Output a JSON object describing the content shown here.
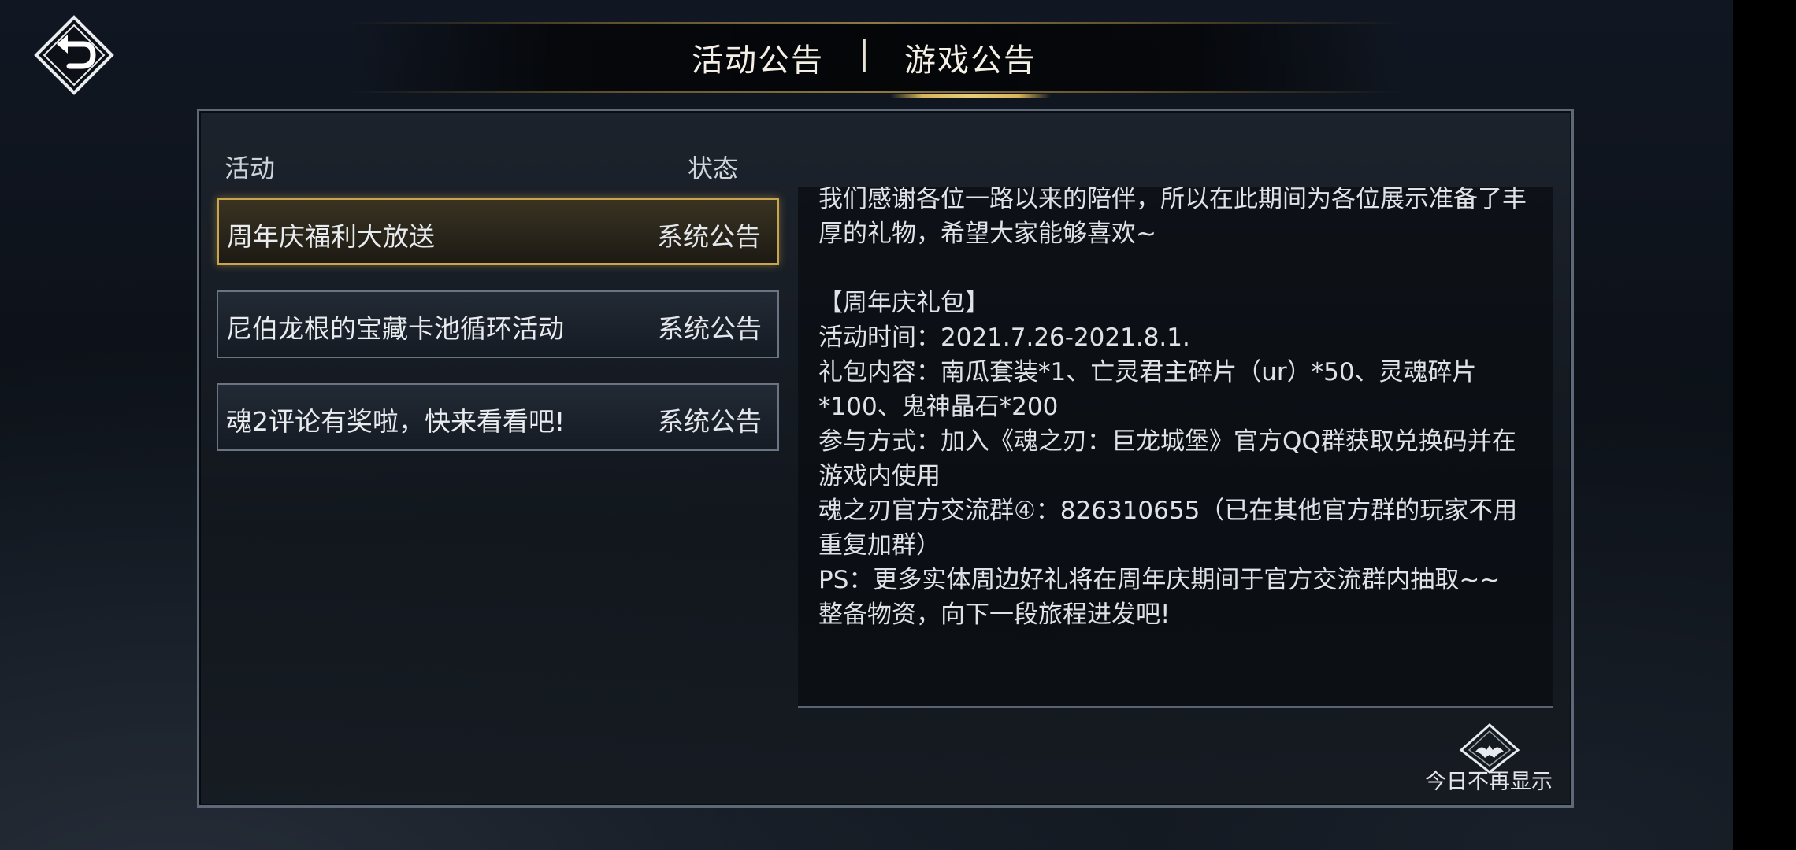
{
  "tabs": {
    "activity": "活动公告",
    "separator": "|",
    "game": "游戏公告"
  },
  "list": {
    "col_activity": "活动",
    "col_status": "状态",
    "items": [
      {
        "title": "周年庆福利大放送",
        "status": "系统公告",
        "selected": true
      },
      {
        "title": "尼伯龙根的宝藏卡池循环活动",
        "status": "系统公告",
        "selected": false
      },
      {
        "title": "魂2评论有奖啦，快来看看吧!",
        "status": "系统公告",
        "selected": false
      }
    ]
  },
  "content": {
    "text": "我们感谢各位一路以来的陪伴，所以在此期间为各位展示准备了丰厚的礼物，希望大家能够喜欢~\n\n【周年庆礼包】\n活动时间：2021.7.26-2021.8.1.\n礼包内容：南瓜套装*1、亡灵君主碎片（ur）*50、灵魂碎片*100、鬼神晶石*200\n参与方式：加入《魂之刃：巨龙城堡》官方QQ群获取兑换码并在游戏内使用\n魂之刃官方交流群④：826310655（已在其他官方群的玩家不用重复加群）\nPS：更多实体周边好礼将在周年庆期间于官方交流群内抽取~~\n整备物资，向下一段旅程进发吧!"
  },
  "footer": {
    "hide_today": "今日不再显示"
  },
  "colors": {
    "accent_gold": "#c9a54e",
    "panel_border": "#5d6878",
    "text": "#dfe3e8"
  },
  "icons": {
    "back": "back-arrow-icon",
    "hide_today": "diamond-bat-icon"
  }
}
